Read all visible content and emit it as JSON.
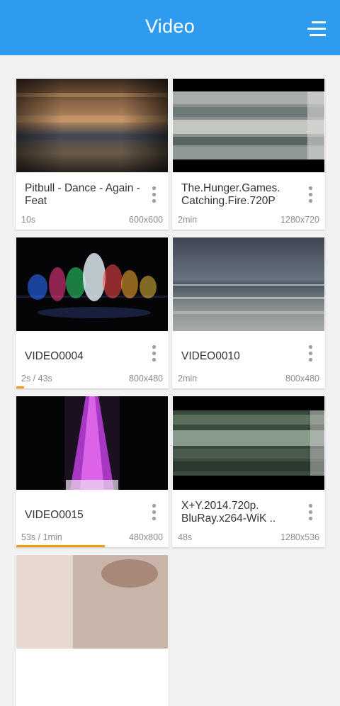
{
  "header": {
    "title": "Video",
    "menu_icon": "hamburger-menu-icon",
    "background": "#2f9bef"
  },
  "videos": [
    {
      "name": "Pitbull - Dance - Again - Feat",
      "duration": "10s",
      "resolution": "600x600",
      "progress": 0
    },
    {
      "name": "The.Hunger.Games. Catching.Fire.720P",
      "duration": "2min",
      "resolution": "1280x720",
      "progress": 0
    },
    {
      "name": "VIDEO0004",
      "duration": "2s / 43s",
      "resolution": "800x480",
      "progress": 0.05
    },
    {
      "name": "VIDEO0010",
      "duration": "2min",
      "resolution": "800x480",
      "progress": 0
    },
    {
      "name": "VIDEO0015",
      "duration": "53s / 1min",
      "resolution": "480x800",
      "progress": 0.58
    },
    {
      "name": "X+Y.2014.720p. BluRay.x264-WiK ..",
      "duration": "48s",
      "resolution": "1280x536",
      "progress": 0
    }
  ],
  "colors": {
    "progress": "#f39c12",
    "overflow_icon": "#9e9e9e"
  }
}
